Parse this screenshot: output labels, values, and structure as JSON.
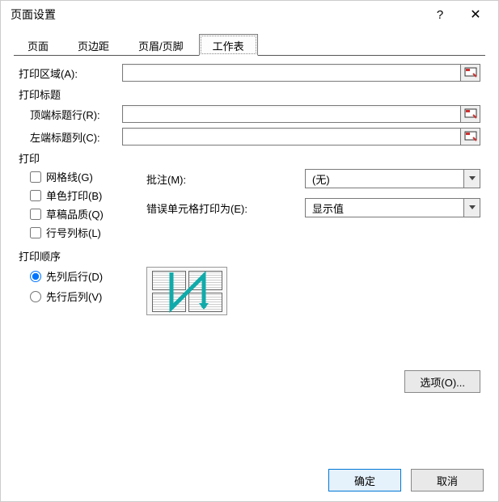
{
  "titlebar": {
    "title": "页面设置"
  },
  "tabs": [
    "页面",
    "页边距",
    "页眉/页脚",
    "工作表"
  ],
  "active_tab": 3,
  "print_area": {
    "label": "打印区域(A):",
    "value": ""
  },
  "titles": {
    "section": "打印标题",
    "top_row": {
      "label": "顶端标题行(R):",
      "value": ""
    },
    "left_col": {
      "label": "左端标题列(C):",
      "value": ""
    }
  },
  "print": {
    "section": "打印",
    "gridlines": "网格线(G)",
    "black_white": "单色打印(B)",
    "draft": "草稿品质(Q)",
    "row_col_headings": "行号列标(L)",
    "comments_label": "批注(M):",
    "comments_value": "(无)",
    "errors_label": "错误单元格打印为(E):",
    "errors_value": "显示值"
  },
  "order": {
    "section": "打印顺序",
    "down_then_over": "先列后行(D)",
    "over_then_down": "先行后列(V)"
  },
  "buttons": {
    "options": "选项(O)...",
    "ok": "确定",
    "cancel": "取消"
  }
}
